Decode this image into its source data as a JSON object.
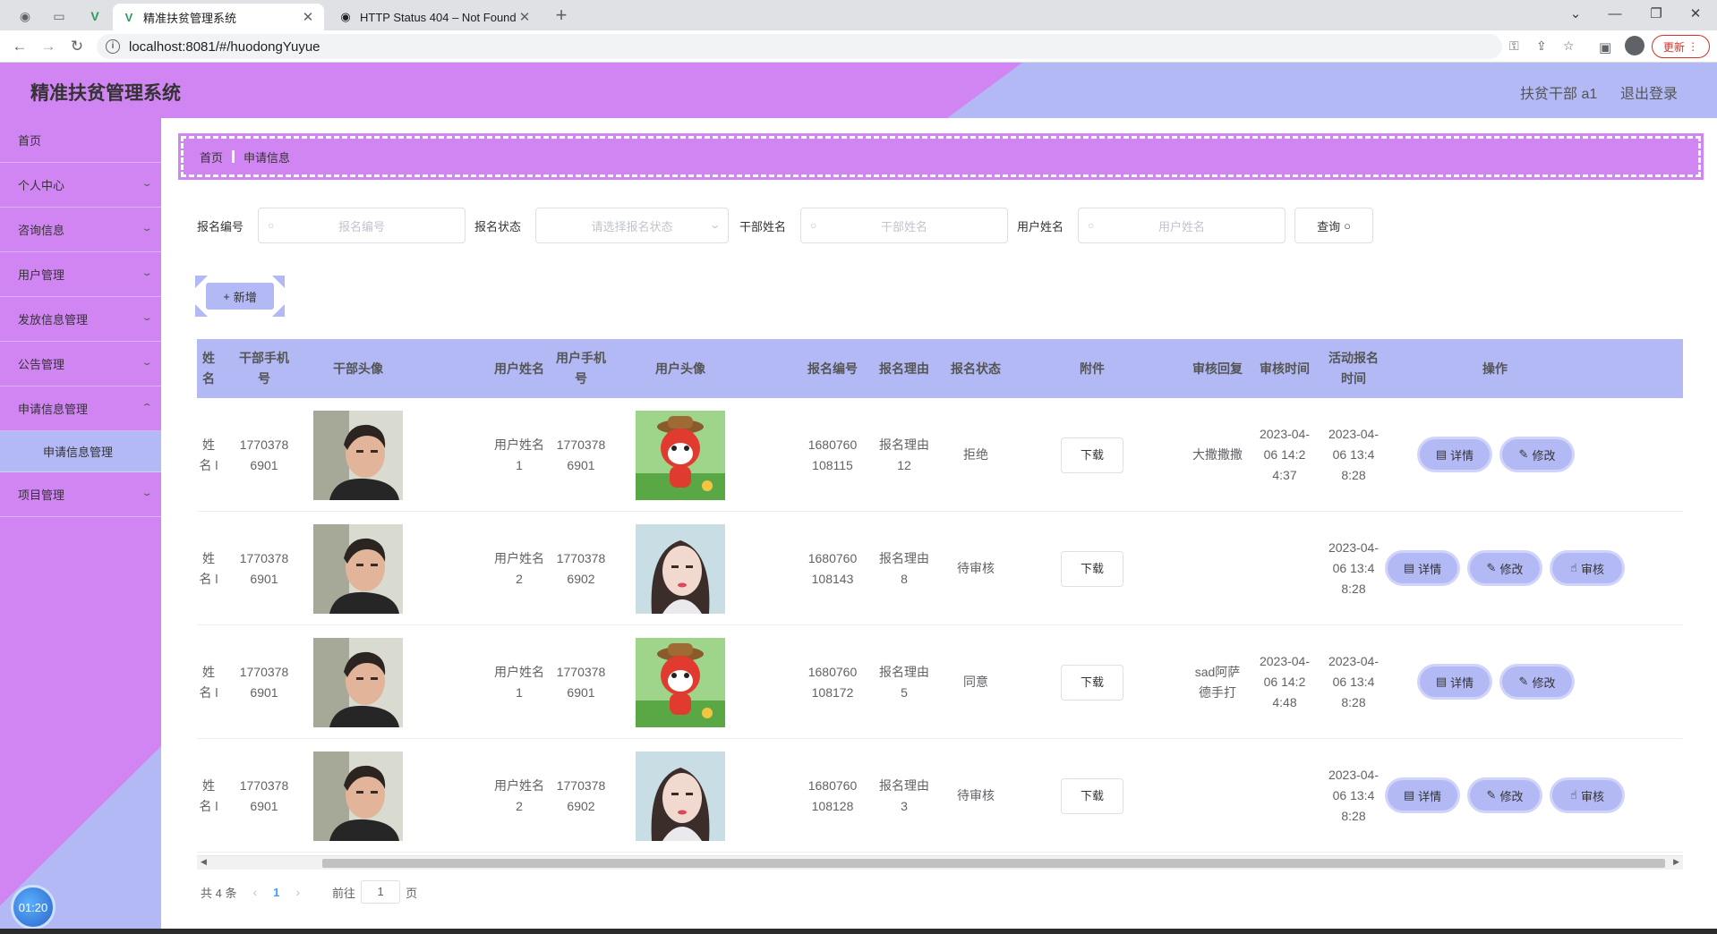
{
  "browser": {
    "tabs": [
      {
        "title": "精准扶贫管理系统",
        "active": true
      },
      {
        "title": "HTTP Status 404 – Not Found",
        "active": false
      }
    ],
    "url": "localhost:8081/#/huodongYuyue",
    "update_label": "更新"
  },
  "header": {
    "title": "精准扶贫管理系统",
    "user": "扶贫干部 a1",
    "logout": "退出登录"
  },
  "sidebar": {
    "items": [
      {
        "label": "首页"
      },
      {
        "label": "个人中心"
      },
      {
        "label": "咨询信息"
      },
      {
        "label": "用户管理"
      },
      {
        "label": "发放信息管理"
      },
      {
        "label": "公告管理"
      },
      {
        "label": "申请信息管理"
      },
      {
        "label": "申请信息管理"
      },
      {
        "label": "项目管理"
      }
    ],
    "clock": "01:20"
  },
  "breadcrumb": {
    "home": "首页",
    "current": "申请信息"
  },
  "filters": {
    "f1_label": "报名编号",
    "f1_placeholder": "报名编号",
    "f2_label": "报名状态",
    "f2_placeholder": "请选择报名状态",
    "f3_label": "干部姓名",
    "f3_placeholder": "干部姓名",
    "f4_label": "用户姓名",
    "f4_placeholder": "用户姓名",
    "query": "查询"
  },
  "add_label": "新增",
  "table": {
    "headers": [
      "姓名",
      "干部手机号",
      "干部头像",
      "用户姓名",
      "用户手机号",
      "用户头像",
      "报名编号",
      "报名理由",
      "报名状态",
      "附件",
      "审核回复",
      "审核时间",
      "活动报名时间",
      "操作"
    ],
    "rows": [
      {
        "name": "姓名 l",
        "phone": "17703786901",
        "uname": "用户姓名1",
        "uphone": "17703786901",
        "uavatar": "fox",
        "no": "1680760108115",
        "reason": "报名理由12",
        "status": "拒绝",
        "file": "下载",
        "reply": "大撒撒撒",
        "rtime": "2023-04-06 14:24:37",
        "atime": "2023-04-06 13:48:28",
        "actions": [
          "详情",
          "修改"
        ]
      },
      {
        "name": "姓名 l",
        "phone": "17703786901",
        "uname": "用户姓名2",
        "uphone": "17703786902",
        "uavatar": "girl",
        "no": "1680760108143",
        "reason": "报名理由8",
        "status": "待审核",
        "file": "下载",
        "reply": "",
        "rtime": "",
        "atime": "2023-04-06 13:48:28",
        "actions": [
          "详情",
          "修改",
          "审核"
        ]
      },
      {
        "name": "姓名 l",
        "phone": "17703786901",
        "uname": "用户姓名1",
        "uphone": "17703786901",
        "uavatar": "fox",
        "no": "1680760108172",
        "reason": "报名理由5",
        "status": "同意",
        "file": "下载",
        "reply": "sad阿萨德手打",
        "rtime": "2023-04-06 14:24:48",
        "atime": "2023-04-06 13:48:28",
        "actions": [
          "详情",
          "修改"
        ]
      },
      {
        "name": "姓名 l",
        "phone": "17703786901",
        "uname": "用户姓名2",
        "uphone": "17703786902",
        "uavatar": "girl",
        "no": "1680760108128",
        "reason": "报名理由3",
        "status": "待审核",
        "file": "下载",
        "reply": "",
        "rtime": "",
        "atime": "2023-04-06 13:48:28",
        "actions": [
          "详情",
          "修改",
          "审核"
        ]
      }
    ]
  },
  "pagination": {
    "total": "共 4 条",
    "current": "1",
    "goto": "前往",
    "page_value": "1",
    "page_suffix": "页"
  }
}
